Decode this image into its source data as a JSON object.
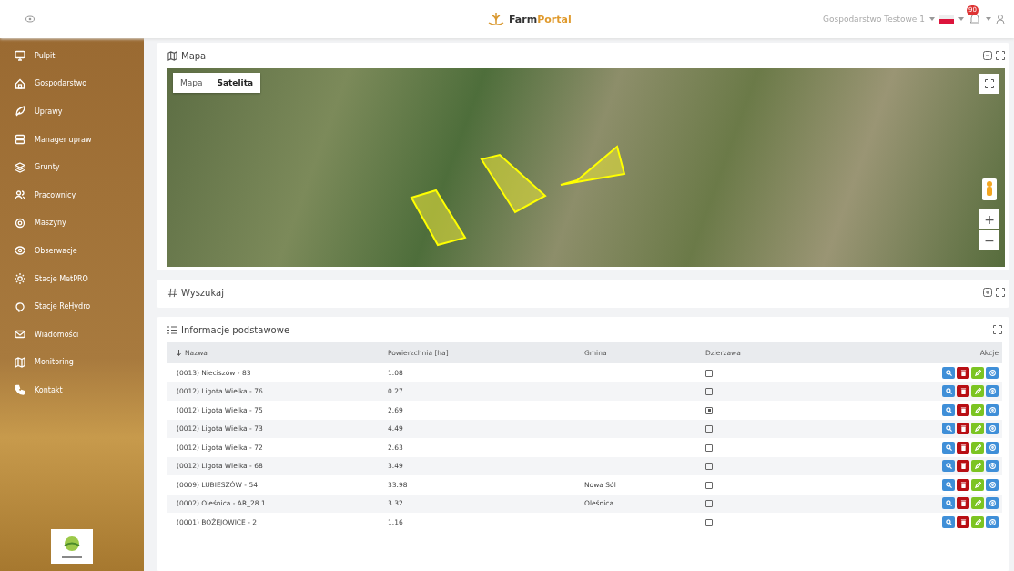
{
  "header": {
    "logo_part1": "Farm",
    "logo_part2": "Portal",
    "farm_select": "Gospodarstwo Testowe 1",
    "notifications_badge": "90"
  },
  "sidebar": {
    "items": [
      {
        "label": "Pulpit",
        "selected": false
      },
      {
        "label": "Gospodarstwo",
        "selected": false
      },
      {
        "label": "Uprawy",
        "selected": false
      },
      {
        "label": "Manager upraw",
        "selected": false
      },
      {
        "label": "Grunty",
        "selected": false
      },
      {
        "label": "Pracownicy",
        "selected": false
      },
      {
        "label": "Maszyny",
        "selected": false
      },
      {
        "label": "Obserwacje",
        "selected": false
      },
      {
        "label": "Stacje MetPRO",
        "selected": false
      },
      {
        "label": "Stacje ReHydro",
        "selected": false
      },
      {
        "label": "Wiadomości",
        "selected": false
      },
      {
        "label": "Monitoring",
        "selected": false
      },
      {
        "label": "Kontakt",
        "selected": false
      }
    ]
  },
  "map_panel": {
    "title": "Mapa",
    "map_types": [
      {
        "label": "Mapa",
        "selected": false
      },
      {
        "label": "Satelita",
        "selected": true
      }
    ],
    "zoom_in": "+",
    "zoom_out": "−"
  },
  "search_panel": {
    "title": "Wyszukaj"
  },
  "info_panel": {
    "title": "Informacje podstawowe",
    "columns": [
      "Nazwa",
      "Powierzchnia [ha]",
      "Gmina",
      "Dzierżawa",
      "Akcje"
    ],
    "rows": [
      {
        "name": "(0013) Nieciszów - 83",
        "area": "1.08",
        "lease": false
      },
      {
        "name": "(0012) Ligota Wielka - 76",
        "area": "0.27",
        "lease": false
      },
      {
        "name": "(0012) Ligota Wielka - 75",
        "area": "2.69",
        "lease": true
      },
      {
        "name": "(0012) Ligota Wielka - 73",
        "area": "4.49",
        "lease": false
      },
      {
        "name": "(0012) Ligota Wielka - 72",
        "area": "2.63",
        "lease": false
      },
      {
        "name": "(0012) Ligota Wielka - 68",
        "area": "3.49",
        "lease": false
      },
      {
        "name": "(0009) LUBIESZÓW - 54",
        "area": "33.98",
        "commune": "Nowa Sól",
        "lease": false
      },
      {
        "name": "(0002) Oleśnica - AR_28.1",
        "area": "3.32",
        "commune": "Oleśnica",
        "lease": false
      },
      {
        "name": "(0001) BOŻEJOWICE - 2",
        "area": "1.16",
        "lease": false
      }
    ]
  }
}
